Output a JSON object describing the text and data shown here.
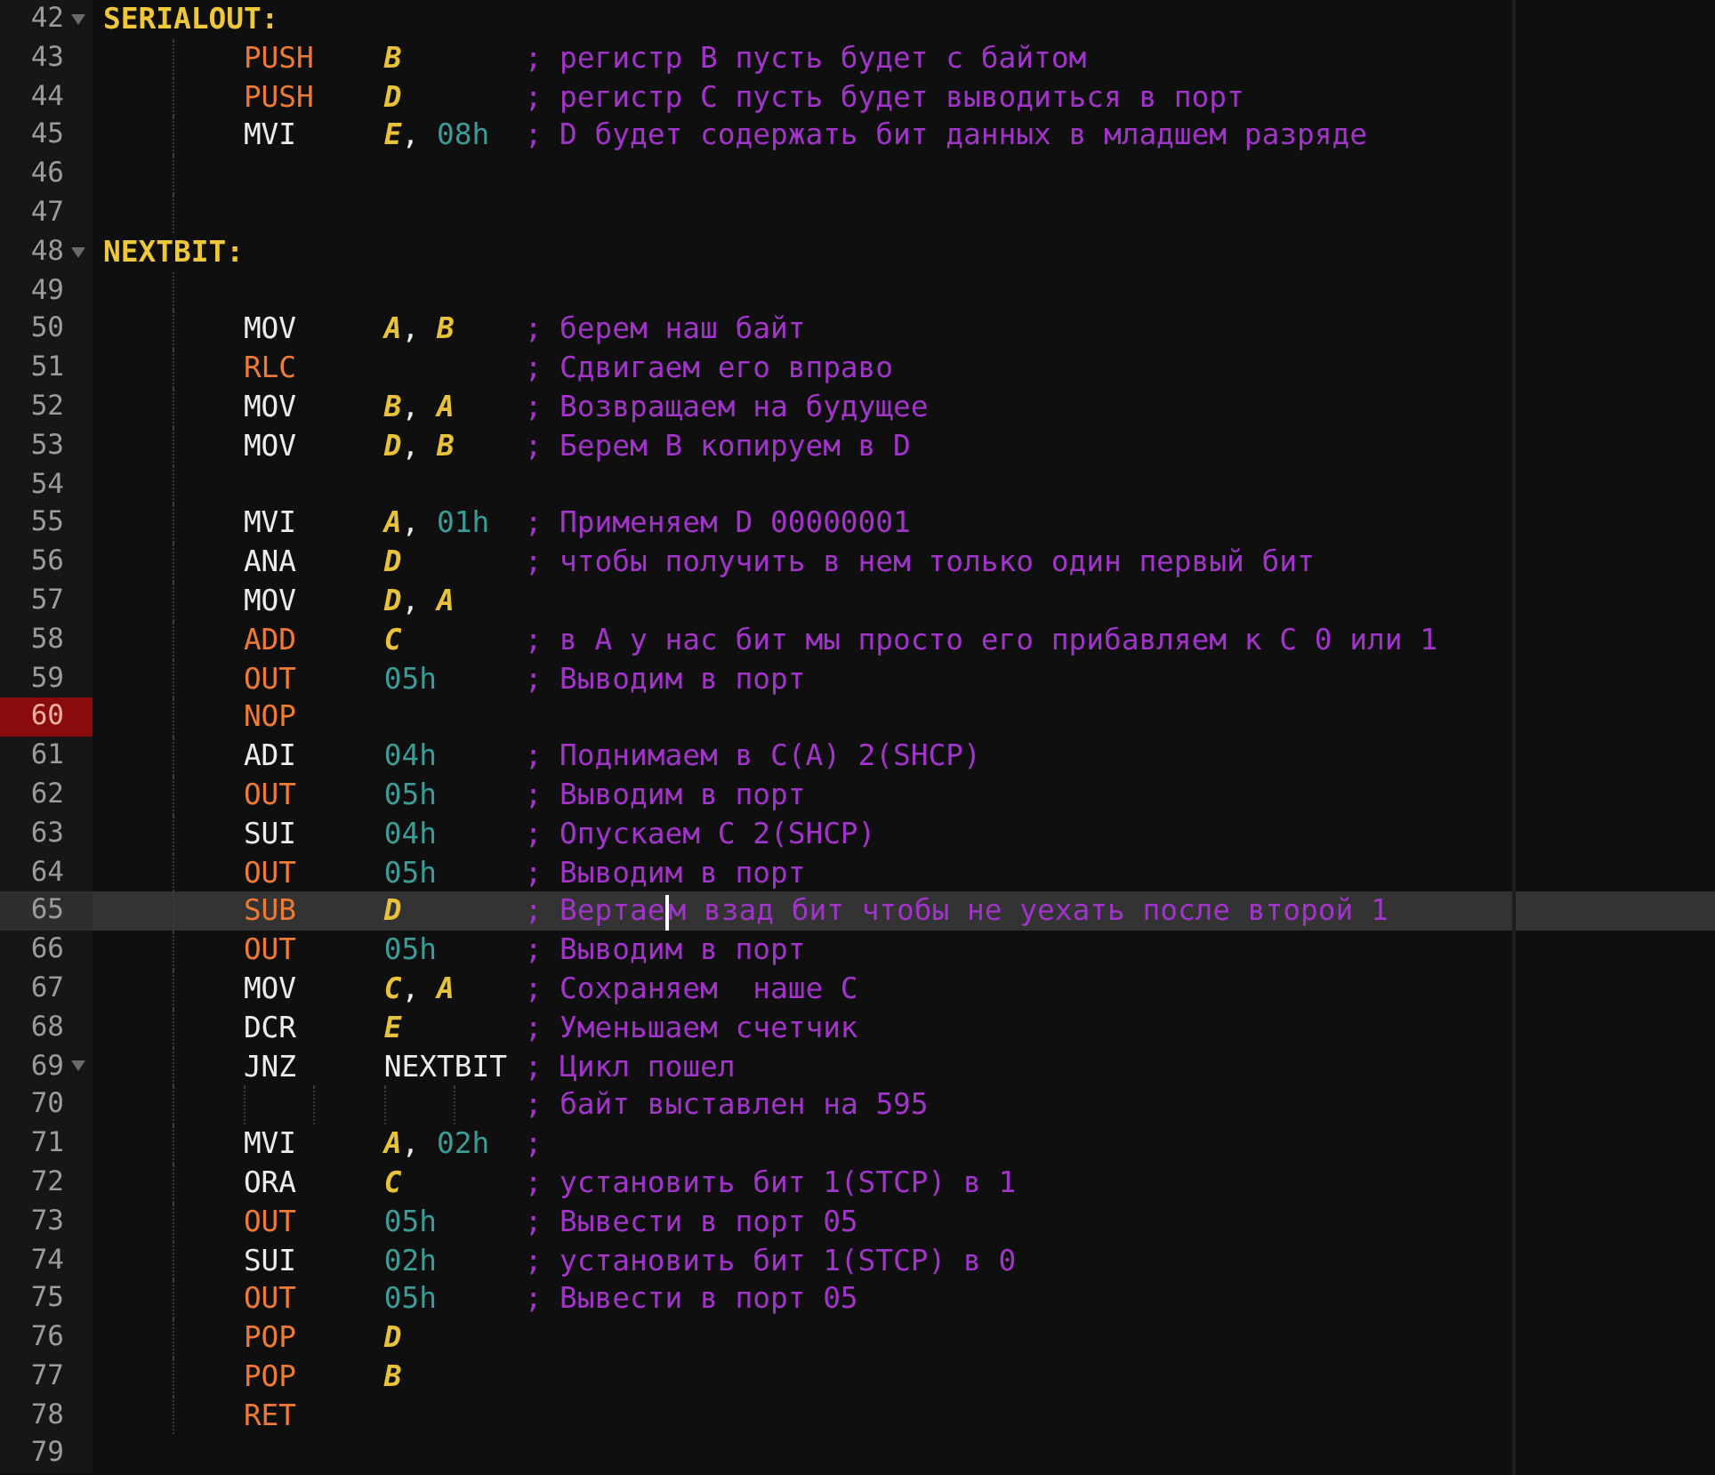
{
  "editor": {
    "lines": [
      {
        "number": "42",
        "label": "SERIALOUT:",
        "breakpoint": false,
        "current": false,
        "foldable": true
      },
      {
        "number": "43",
        "op": {
          "kind": "keyword",
          "text": "PUSH"
        },
        "args": [
          {
            "kind": "register",
            "text": "B"
          }
        ],
        "comment": "; регистр В пусть будет с байтом",
        "breakpoint": false,
        "current": false,
        "foldable": false
      },
      {
        "number": "44",
        "op": {
          "kind": "keyword",
          "text": "PUSH"
        },
        "args": [
          {
            "kind": "register",
            "text": "D"
          }
        ],
        "comment": "; регистр С пусть будет выводиться в порт",
        "breakpoint": false,
        "current": false,
        "foldable": false
      },
      {
        "number": "45",
        "op": {
          "kind": "mnemonic",
          "text": "MVI"
        },
        "args": [
          {
            "kind": "register",
            "text": "E"
          },
          {
            "kind": "punct",
            "text": ","
          },
          {
            "kind": "number",
            "text": "08h"
          }
        ],
        "comment": "; D будет содержать бит данных в младшем разряде",
        "breakpoint": false,
        "current": false,
        "foldable": false
      },
      {
        "number": "46",
        "breakpoint": false,
        "current": false,
        "foldable": false
      },
      {
        "number": "47",
        "breakpoint": false,
        "current": false,
        "foldable": false
      },
      {
        "number": "48",
        "label": "NEXTBIT:",
        "breakpoint": false,
        "current": false,
        "foldable": true
      },
      {
        "number": "49",
        "breakpoint": false,
        "current": false,
        "foldable": false
      },
      {
        "number": "50",
        "op": {
          "kind": "mnemonic",
          "text": "MOV"
        },
        "args": [
          {
            "kind": "register",
            "text": "A"
          },
          {
            "kind": "punct",
            "text": ","
          },
          {
            "kind": "register",
            "text": "B"
          }
        ],
        "comment": "; берем наш байт",
        "breakpoint": false,
        "current": false,
        "foldable": false
      },
      {
        "number": "51",
        "op": {
          "kind": "keyword",
          "text": "RLC"
        },
        "comment": "; Сдвигаем его вправо",
        "breakpoint": false,
        "current": false,
        "foldable": false
      },
      {
        "number": "52",
        "op": {
          "kind": "mnemonic",
          "text": "MOV"
        },
        "args": [
          {
            "kind": "register",
            "text": "B"
          },
          {
            "kind": "punct",
            "text": ","
          },
          {
            "kind": "register",
            "text": "A"
          }
        ],
        "comment": "; Возвращаем на будущее",
        "breakpoint": false,
        "current": false,
        "foldable": false
      },
      {
        "number": "53",
        "op": {
          "kind": "mnemonic",
          "text": "MOV"
        },
        "args": [
          {
            "kind": "register",
            "text": "D"
          },
          {
            "kind": "punct",
            "text": ","
          },
          {
            "kind": "register",
            "text": "B"
          }
        ],
        "comment": "; Берем В копируем в D",
        "breakpoint": false,
        "current": false,
        "foldable": false
      },
      {
        "number": "54",
        "breakpoint": false,
        "current": false,
        "foldable": false
      },
      {
        "number": "55",
        "op": {
          "kind": "mnemonic",
          "text": "MVI"
        },
        "args": [
          {
            "kind": "register",
            "text": "A"
          },
          {
            "kind": "punct",
            "text": ","
          },
          {
            "kind": "number",
            "text": "01h"
          }
        ],
        "comment": "; Применяем D 00000001",
        "breakpoint": false,
        "current": false,
        "foldable": false
      },
      {
        "number": "56",
        "op": {
          "kind": "mnemonic",
          "text": "ANA"
        },
        "args": [
          {
            "kind": "register",
            "text": "D"
          }
        ],
        "comment": "; чтобы получить в нем только один первый бит",
        "breakpoint": false,
        "current": false,
        "foldable": false
      },
      {
        "number": "57",
        "op": {
          "kind": "mnemonic",
          "text": "MOV"
        },
        "args": [
          {
            "kind": "register",
            "text": "D"
          },
          {
            "kind": "punct",
            "text": ","
          },
          {
            "kind": "register",
            "text": "A"
          }
        ],
        "breakpoint": false,
        "current": false,
        "foldable": false
      },
      {
        "number": "58",
        "op": {
          "kind": "keyword",
          "text": "ADD"
        },
        "args": [
          {
            "kind": "register",
            "text": "C"
          }
        ],
        "comment": "; в А у нас бит мы просто его прибавляем к С 0 или 1",
        "breakpoint": false,
        "current": false,
        "foldable": false
      },
      {
        "number": "59",
        "op": {
          "kind": "keyword",
          "text": "OUT"
        },
        "args": [
          {
            "kind": "number",
            "text": "05h"
          }
        ],
        "comment": "; Выводим в порт",
        "breakpoint": false,
        "current": false,
        "foldable": false
      },
      {
        "number": "60",
        "op": {
          "kind": "keyword",
          "text": "NOP"
        },
        "breakpoint": true,
        "current": false,
        "foldable": false
      },
      {
        "number": "61",
        "op": {
          "kind": "mnemonic",
          "text": "ADI"
        },
        "args": [
          {
            "kind": "number",
            "text": "04h"
          }
        ],
        "comment": "; Поднимаем в С(А) 2(SHCP)",
        "breakpoint": false,
        "current": false,
        "foldable": false
      },
      {
        "number": "62",
        "op": {
          "kind": "keyword",
          "text": "OUT"
        },
        "args": [
          {
            "kind": "number",
            "text": "05h"
          }
        ],
        "comment": "; Выводим в порт",
        "breakpoint": false,
        "current": false,
        "foldable": false
      },
      {
        "number": "63",
        "op": {
          "kind": "mnemonic",
          "text": "SUI"
        },
        "args": [
          {
            "kind": "number",
            "text": "04h"
          }
        ],
        "comment": "; Опускаем С 2(SHCP)",
        "breakpoint": false,
        "current": false,
        "foldable": false
      },
      {
        "number": "64",
        "op": {
          "kind": "keyword",
          "text": "OUT"
        },
        "args": [
          {
            "kind": "number",
            "text": "05h"
          }
        ],
        "comment": "; Выводим в порт",
        "breakpoint": false,
        "current": false,
        "foldable": false
      },
      {
        "number": "65",
        "op": {
          "kind": "keyword",
          "text": "SUB"
        },
        "args": [
          {
            "kind": "register",
            "text": "D"
          }
        ],
        "comment": [
          "; Вертае",
          "м взад бит чтобы не уехать после второй 1"
        ],
        "breakpoint": false,
        "current": true,
        "foldable": false
      },
      {
        "number": "66",
        "op": {
          "kind": "keyword",
          "text": "OUT"
        },
        "args": [
          {
            "kind": "number",
            "text": "05h"
          }
        ],
        "comment": "; Выводим в порт",
        "breakpoint": false,
        "current": false,
        "foldable": false
      },
      {
        "number": "67",
        "op": {
          "kind": "mnemonic",
          "text": "MOV"
        },
        "args": [
          {
            "kind": "register",
            "text": "C"
          },
          {
            "kind": "punct",
            "text": ","
          },
          {
            "kind": "register",
            "text": "A"
          }
        ],
        "comment": "; Сохраняем  наше С",
        "breakpoint": false,
        "current": false,
        "foldable": false
      },
      {
        "number": "68",
        "op": {
          "kind": "mnemonic",
          "text": "DCR"
        },
        "args": [
          {
            "kind": "register",
            "text": "E"
          }
        ],
        "comment": "; Уменьшаем счетчик",
        "breakpoint": false,
        "current": false,
        "foldable": false
      },
      {
        "number": "69",
        "op": {
          "kind": "mnemonic",
          "text": "JNZ"
        },
        "args": [
          {
            "kind": "symbol",
            "text": "NEXTBIT"
          }
        ],
        "comment": "; Цикл пошел",
        "breakpoint": false,
        "current": false,
        "foldable": true
      },
      {
        "number": "70",
        "comment": "; байт выставлен на 595",
        "breakpoint": false,
        "current": false,
        "foldable": false
      },
      {
        "number": "71",
        "op": {
          "kind": "mnemonic",
          "text": "MVI"
        },
        "args": [
          {
            "kind": "register",
            "text": "A"
          },
          {
            "kind": "punct",
            "text": ","
          },
          {
            "kind": "number",
            "text": "02h"
          }
        ],
        "comment": ";",
        "breakpoint": false,
        "current": false,
        "foldable": false
      },
      {
        "number": "72",
        "op": {
          "kind": "mnemonic",
          "text": "ORA"
        },
        "args": [
          {
            "kind": "register",
            "text": "C"
          }
        ],
        "comment": "; установить бит 1(STCP) в 1",
        "breakpoint": false,
        "current": false,
        "foldable": false
      },
      {
        "number": "73",
        "op": {
          "kind": "keyword",
          "text": "OUT"
        },
        "args": [
          {
            "kind": "number",
            "text": "05h"
          }
        ],
        "comment": "; Вывести в порт 05",
        "breakpoint": false,
        "current": false,
        "foldable": false
      },
      {
        "number": "74",
        "op": {
          "kind": "mnemonic",
          "text": "SUI"
        },
        "args": [
          {
            "kind": "number",
            "text": "02h"
          }
        ],
        "comment": "; установить бит 1(STCP) в 0",
        "breakpoint": false,
        "current": false,
        "foldable": false
      },
      {
        "number": "75",
        "op": {
          "kind": "keyword",
          "text": "OUT"
        },
        "args": [
          {
            "kind": "number",
            "text": "05h"
          }
        ],
        "comment": "; Вывести в порт 05",
        "breakpoint": false,
        "current": false,
        "foldable": false
      },
      {
        "number": "76",
        "op": {
          "kind": "keyword",
          "text": "POP"
        },
        "args": [
          {
            "kind": "register",
            "text": "D"
          }
        ],
        "breakpoint": false,
        "current": false,
        "foldable": false
      },
      {
        "number": "77",
        "op": {
          "kind": "keyword",
          "text": "POP"
        },
        "args": [
          {
            "kind": "register",
            "text": "B"
          }
        ],
        "breakpoint": false,
        "current": false,
        "foldable": false
      },
      {
        "number": "78",
        "op": {
          "kind": "keyword",
          "text": "RET"
        },
        "breakpoint": false,
        "current": false,
        "foldable": false
      },
      {
        "number": "79",
        "breakpoint": false,
        "current": false,
        "foldable": false
      }
    ]
  }
}
